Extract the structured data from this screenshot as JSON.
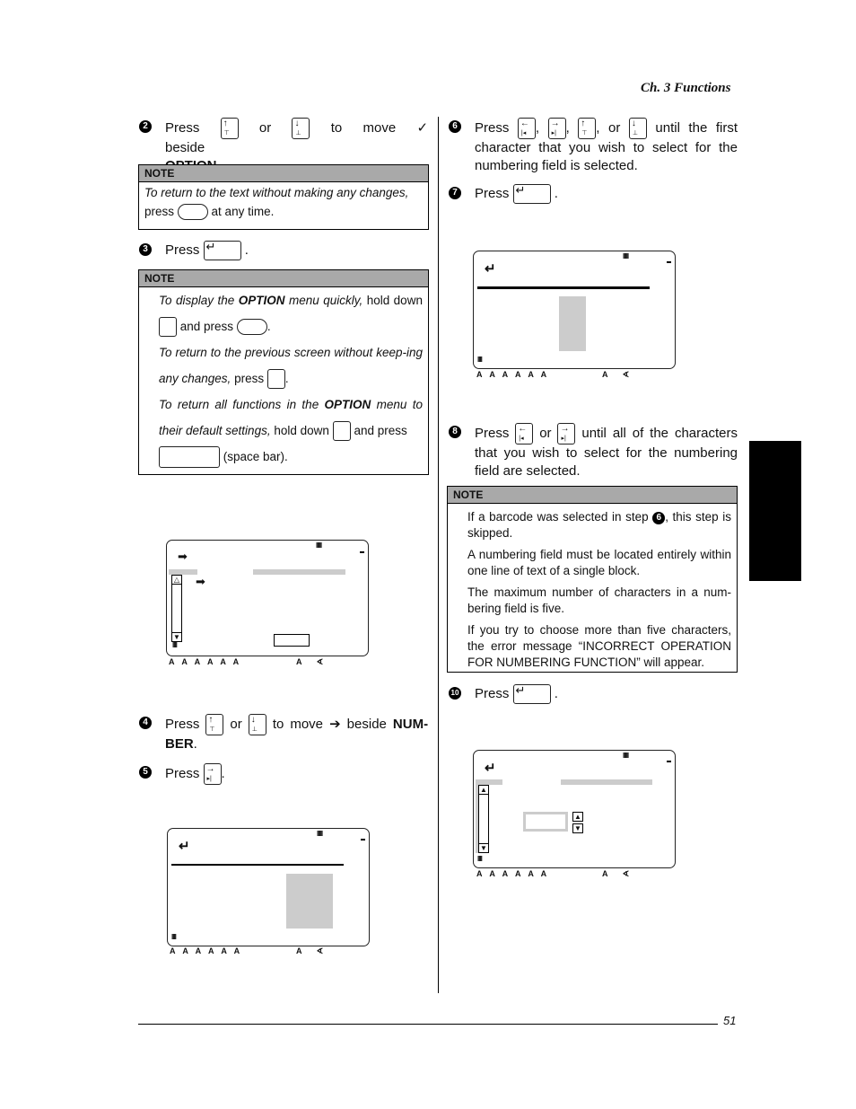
{
  "header": {
    "chapter": "Ch. 3 Functions"
  },
  "footer": {
    "page_number": "51"
  },
  "common": {
    "press": "Press",
    "or": "or",
    "period": ".",
    "comma": ","
  },
  "left_column": {
    "step2": {
      "number": "2",
      "text_to_move": "to move",
      "check_glyph": "✓",
      "text_beside": "beside",
      "bold": "OPTION",
      "end": "."
    },
    "note1": {
      "title": "NOTE",
      "line1": "To return to the text without making any changes,",
      "line2_a": "press",
      "line2_b": "at any time."
    },
    "step3": {
      "number": "3"
    },
    "note2": {
      "title": "NOTE",
      "p1_a": "To display the",
      "p1_bold": "OPTION",
      "p1_b": "menu quickly,",
      "p1_c": "hold down",
      "p1_d": "and press",
      "p2_a": "To return to the previous screen without keep-ing any changes,",
      "p2_b": "press",
      "p3_a": "To return all functions in the",
      "p3_bold": "OPTION",
      "p3_b": "menu to their default settings,",
      "p3_c": "hold down",
      "p3_d": "and press",
      "p3_e": "(space bar)."
    },
    "step4": {
      "number": "4",
      "text_to_move": "to move",
      "arrow_glyph": "➔",
      "text_beside": "beside",
      "bold": "NUM-BER",
      "end": "."
    },
    "step5": {
      "number": "5"
    }
  },
  "right_column": {
    "step6": {
      "number": "6",
      "text": "until the first character that you wish to select for the numbering field is selected."
    },
    "step7": {
      "number": "7"
    },
    "step8": {
      "number": "8",
      "text": "until all of the characters that you wish to select for the numbering field are selected."
    },
    "note3": {
      "title": "NOTE",
      "p1_a": "If a barcode was selected in step",
      "p1_ref": "6",
      "p1_b": ", this step is skipped.",
      "p2": "A numbering field must be located entirely within one line of text of a single block.",
      "p3": "The maximum number of characters in a num-bering field is five.",
      "p4": "If you try to choose more than five characters, the error message “INCORRECT OPERATION FOR NUMBERING FUNCTION” will appear."
    },
    "step10": {
      "number": "10"
    }
  },
  "keys": {
    "up": {
      "arrow": "↑",
      "sub": "⊤"
    },
    "down": {
      "arrow": "↓",
      "sub": "⊥"
    },
    "left": {
      "arrow": "←",
      "sub": "|◂"
    },
    "right": {
      "arrow": "→",
      "sub": "▸|"
    },
    "enter": {
      "arrow": "↵"
    }
  },
  "lcd": {
    "battery": "IIIII",
    "tape": "IIII",
    "legend": "A A A A A A",
    "legend_right": "A ∢",
    "arrow_glyph": "➡",
    "enter_glyph": "↵",
    "scroll_up": "▲",
    "scroll_down": "▼"
  }
}
